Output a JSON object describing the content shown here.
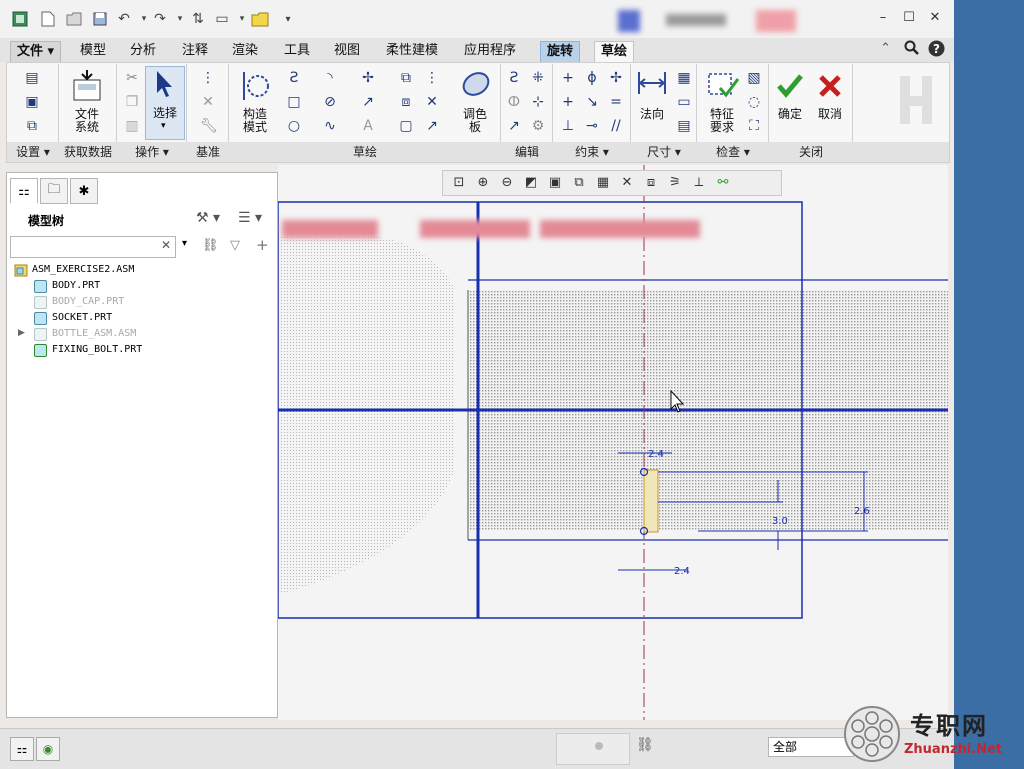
{
  "title_bar": {
    "quick_access": [
      "app-icon",
      "new-icon",
      "open-icon",
      "save-icon",
      "undo-icon",
      "redo-icon",
      "regenerate-icon",
      "window-icon",
      "folder-icon",
      "dropdown-icon"
    ],
    "window_buttons": [
      "–",
      "☐",
      "✕"
    ]
  },
  "menu_tabs": [
    {
      "label": "文件",
      "kind": "file"
    },
    {
      "label": "模型"
    },
    {
      "label": "分析"
    },
    {
      "label": "注释"
    },
    {
      "label": "渲染"
    },
    {
      "label": "工具"
    },
    {
      "label": "视图"
    },
    {
      "label": "柔性建模"
    },
    {
      "label": "应用程序"
    },
    {
      "label": "旋转",
      "kind": "active"
    },
    {
      "label": "草绘",
      "kind": "active2"
    }
  ],
  "ribbon": {
    "file_system": "文件\n系统",
    "select": "选择",
    "construction_mode": "构造\n模式",
    "palette": "调色\n板",
    "normal": "法向",
    "feature_requirements": "特征\n要求",
    "ok": "确定",
    "cancel": "取消",
    "groups": [
      "设置 ▾",
      "获取数据",
      "操作 ▾",
      "基准",
      "草绘",
      "编辑",
      "约束 ▾",
      "尺寸 ▾",
      "检查 ▾",
      "关闭"
    ]
  },
  "model_tree": {
    "title": "模型树",
    "search_placeholder": "",
    "items": [
      {
        "label": "ASM_EXERCISE2.ASM",
        "level": 0,
        "type": "asm",
        "dim": false
      },
      {
        "label": "BODY.PRT",
        "level": 1,
        "type": "prt",
        "dim": false
      },
      {
        "label": "BODY_CAP.PRT",
        "level": 1,
        "type": "prt",
        "dim": true
      },
      {
        "label": "SOCKET.PRT",
        "level": 1,
        "type": "prt",
        "dim": false
      },
      {
        "label": "BOTTLE_ASM.ASM",
        "level": 1,
        "type": "asm",
        "dim": true,
        "expandable": true
      },
      {
        "label": "FIXING_BOLT.PRT",
        "level": 1,
        "type": "prt",
        "dim": false
      }
    ]
  },
  "sketch": {
    "dim_top": "2.4",
    "dim_bottom": "2.4",
    "dim_h1": "3.0",
    "dim_v1": "2.6"
  },
  "status_bar": {
    "filter_value": "全部"
  },
  "watermark": {
    "name": "专职网",
    "url": "Zhuanzhi.Net"
  },
  "colors": {
    "sketch_blue": "#1a2fb0",
    "confirm_green": "#2e9e2e",
    "cancel_red": "#c81e1e",
    "active_tab": "#b8d2ec"
  }
}
